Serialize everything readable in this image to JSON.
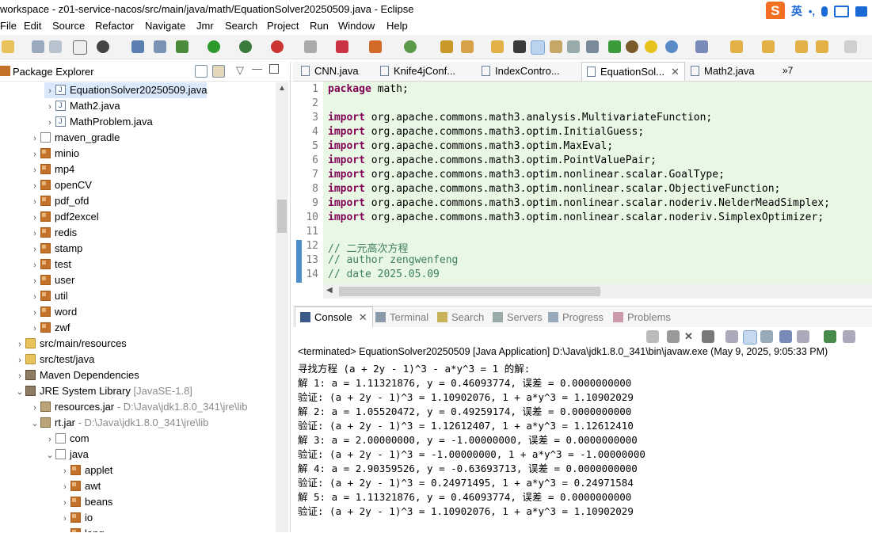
{
  "window": {
    "title": "workspace - z01-service-nacos/src/main/java/math/EquationSolver20250509.java - Eclipse"
  },
  "ime": {
    "logo": "S",
    "lang": "英"
  },
  "menu": [
    "File",
    "Edit",
    "Source",
    "Refactor",
    "Navigate",
    "Jmr",
    "Search",
    "Project",
    "Run",
    "Window",
    "Help"
  ],
  "package_explorer": {
    "title": "Package Explorer",
    "tree": [
      {
        "label": "EquationSolver20250509.java",
        "suffix": "",
        "arrow": ">",
        "indent": 3,
        "icon": "jfile",
        "selected": true
      },
      {
        "label": "Math2.java",
        "suffix": "",
        "arrow": ">",
        "indent": 3,
        "icon": "jfile"
      },
      {
        "label": "MathProblem.java",
        "suffix": "",
        "arrow": ">",
        "indent": 3,
        "icon": "jfile"
      },
      {
        "label": "maven_gradle",
        "suffix": "",
        "arrow": ">",
        "indent": 2,
        "icon": "pkg2"
      },
      {
        "label": "minio",
        "suffix": "",
        "arrow": ">",
        "indent": 2,
        "icon": "pkg"
      },
      {
        "label": "mp4",
        "suffix": "",
        "arrow": ">",
        "indent": 2,
        "icon": "pkg"
      },
      {
        "label": "openCV",
        "suffix": "",
        "arrow": ">",
        "indent": 2,
        "icon": "pkg"
      },
      {
        "label": "pdf_ofd",
        "suffix": "",
        "arrow": ">",
        "indent": 2,
        "icon": "pkg"
      },
      {
        "label": "pdf2excel",
        "suffix": "",
        "arrow": ">",
        "indent": 2,
        "icon": "pkg"
      },
      {
        "label": "redis",
        "suffix": "",
        "arrow": ">",
        "indent": 2,
        "icon": "pkg"
      },
      {
        "label": "stamp",
        "suffix": "",
        "arrow": ">",
        "indent": 2,
        "icon": "pkg"
      },
      {
        "label": "test",
        "suffix": "",
        "arrow": ">",
        "indent": 2,
        "icon": "pkg"
      },
      {
        "label": "user",
        "suffix": "",
        "arrow": ">",
        "indent": 2,
        "icon": "pkg"
      },
      {
        "label": "util",
        "suffix": "",
        "arrow": ">",
        "indent": 2,
        "icon": "pkg"
      },
      {
        "label": "word",
        "suffix": "",
        "arrow": ">",
        "indent": 2,
        "icon": "pkg"
      },
      {
        "label": "zwf",
        "suffix": "",
        "arrow": ">",
        "indent": 2,
        "icon": "pkg"
      },
      {
        "label": "src/main/resources",
        "suffix": "",
        "arrow": ">",
        "indent": 1,
        "icon": "folder"
      },
      {
        "label": "src/test/java",
        "suffix": "",
        "arrow": ">",
        "indent": 1,
        "icon": "folder"
      },
      {
        "label": "Maven Dependencies",
        "suffix": "",
        "arrow": ">",
        "indent": 1,
        "icon": "lib"
      },
      {
        "label": "JRE System Library",
        "suffix": " [JavaSE-1.8]",
        "arrow": "v",
        "indent": 1,
        "icon": "lib"
      },
      {
        "label": "resources.jar",
        "suffix": " - D:\\Java\\jdk1.8.0_341\\jre\\lib",
        "arrow": ">",
        "indent": 2,
        "icon": "jar"
      },
      {
        "label": "rt.jar",
        "suffix": " - D:\\Java\\jdk1.8.0_341\\jre\\lib",
        "arrow": "v",
        "indent": 2,
        "icon": "jar"
      },
      {
        "label": "com",
        "suffix": "",
        "arrow": ">",
        "indent": 3,
        "icon": "pkg2"
      },
      {
        "label": "java",
        "suffix": "",
        "arrow": "v",
        "indent": 3,
        "icon": "pkg2"
      },
      {
        "label": "applet",
        "suffix": "",
        "arrow": ">",
        "indent": 4,
        "icon": "pkg"
      },
      {
        "label": "awt",
        "suffix": "",
        "arrow": ">",
        "indent": 4,
        "icon": "pkg"
      },
      {
        "label": "beans",
        "suffix": "",
        "arrow": ">",
        "indent": 4,
        "icon": "pkg"
      },
      {
        "label": "io",
        "suffix": "",
        "arrow": ">",
        "indent": 4,
        "icon": "pkg"
      },
      {
        "label": "lang",
        "suffix": "",
        "arrow": ">",
        "indent": 4,
        "icon": "pkg"
      }
    ]
  },
  "editor": {
    "tabs": [
      "CNN.java",
      "Knife4jConf...",
      "IndexContro...",
      "EquationSol...",
      "Math2.java"
    ],
    "active_tab": 3,
    "overflow": "»7",
    "lines": [
      {
        "n": "1",
        "kw": "package",
        "text": " math;"
      },
      {
        "n": "2",
        "kw": "",
        "text": ""
      },
      {
        "n": "3",
        "kw": "import",
        "text": " org.apache.commons.math3.analysis.MultivariateFunction;"
      },
      {
        "n": "4",
        "kw": "import",
        "text": " org.apache.commons.math3.optim.InitialGuess;"
      },
      {
        "n": "5",
        "kw": "import",
        "text": " org.apache.commons.math3.optim.MaxEval;"
      },
      {
        "n": "6",
        "kw": "import",
        "text": " org.apache.commons.math3.optim.PointValuePair;"
      },
      {
        "n": "7",
        "kw": "import",
        "text": " org.apache.commons.math3.optim.nonlinear.scalar.GoalType;"
      },
      {
        "n": "8",
        "kw": "import",
        "text": " org.apache.commons.math3.optim.nonlinear.scalar.ObjectiveFunction;"
      },
      {
        "n": "9",
        "kw": "import",
        "text": " org.apache.commons.math3.optim.nonlinear.scalar.noderiv.NelderMeadSimplex;"
      },
      {
        "n": "10",
        "kw": "import",
        "text": " org.apache.commons.math3.optim.nonlinear.scalar.noderiv.SimplexOptimizer;"
      },
      {
        "n": "11",
        "kw": "",
        "text": ""
      },
      {
        "n": "12",
        "kw": "",
        "text": "// 二元高次方程",
        "comment": true
      },
      {
        "n": "13",
        "kw": "",
        "text": "// author zengwenfeng",
        "comment": true
      },
      {
        "n": "14",
        "kw": "",
        "text": "// date 2025.05.09",
        "comment": true
      }
    ]
  },
  "console": {
    "tabs": [
      "Console",
      "Terminal",
      "Search",
      "Servers",
      "Progress",
      "Problems"
    ],
    "terminated": "<terminated> EquationSolver20250509 [Java Application] D:\\Java\\jdk1.8.0_341\\bin\\javaw.exe  (May 9, 2025, 9:05:33 PM)",
    "output": [
      "寻找方程 (a + 2y - 1)^3 - a*y^3 = 1 的解:",
      "解 1: a = 1.11321876, y = 0.46093774, 误差 = 0.0000000000",
      "验证: (a + 2y - 1)^3 = 1.10902076, 1 + a*y^3 = 1.10902029",
      "解 2: a = 1.05520472, y = 0.49259174, 误差 = 0.0000000000",
      "验证: (a + 2y - 1)^3 = 1.12612407, 1 + a*y^3 = 1.12612410",
      "解 3: a = 2.00000000, y = -1.00000000, 误差 = 0.0000000000",
      "验证: (a + 2y - 1)^3 = -1.00000000, 1 + a*y^3 = -1.00000000",
      "解 4: a = 2.90359526, y = -0.63693713, 误差 = 0.0000000000",
      "验证: (a + 2y - 1)^3 = 0.24971495, 1 + a*y^3 = 0.24971584",
      "解 5: a = 1.11321876, y = 0.46093774, 误差 = 0.0000000000",
      "验证: (a + 2y - 1)^3 = 1.10902076, 1 + a*y^3 = 1.10902029"
    ]
  }
}
